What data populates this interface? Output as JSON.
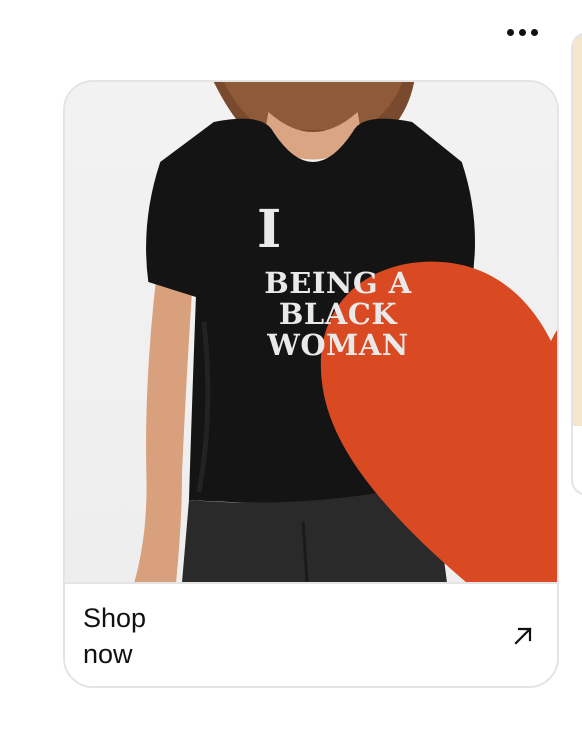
{
  "menu": {
    "icon": "more-horizontal-icon"
  },
  "product_card": {
    "image_alt": "Woman wearing black t-shirt",
    "shirt_print": {
      "first_word": "I",
      "heart_icon": "heart-icon",
      "heart_color": "#d94a22",
      "lines": [
        "BEING A",
        "BLACK",
        "WOMAN"
      ]
    },
    "cta": {
      "label": "Shop now",
      "icon": "arrow-up-right-icon"
    }
  },
  "colors": {
    "card_border": "#e4e4e4",
    "shirt": "#141414",
    "text": "#111111",
    "peek_card": "#f3e6cc"
  }
}
